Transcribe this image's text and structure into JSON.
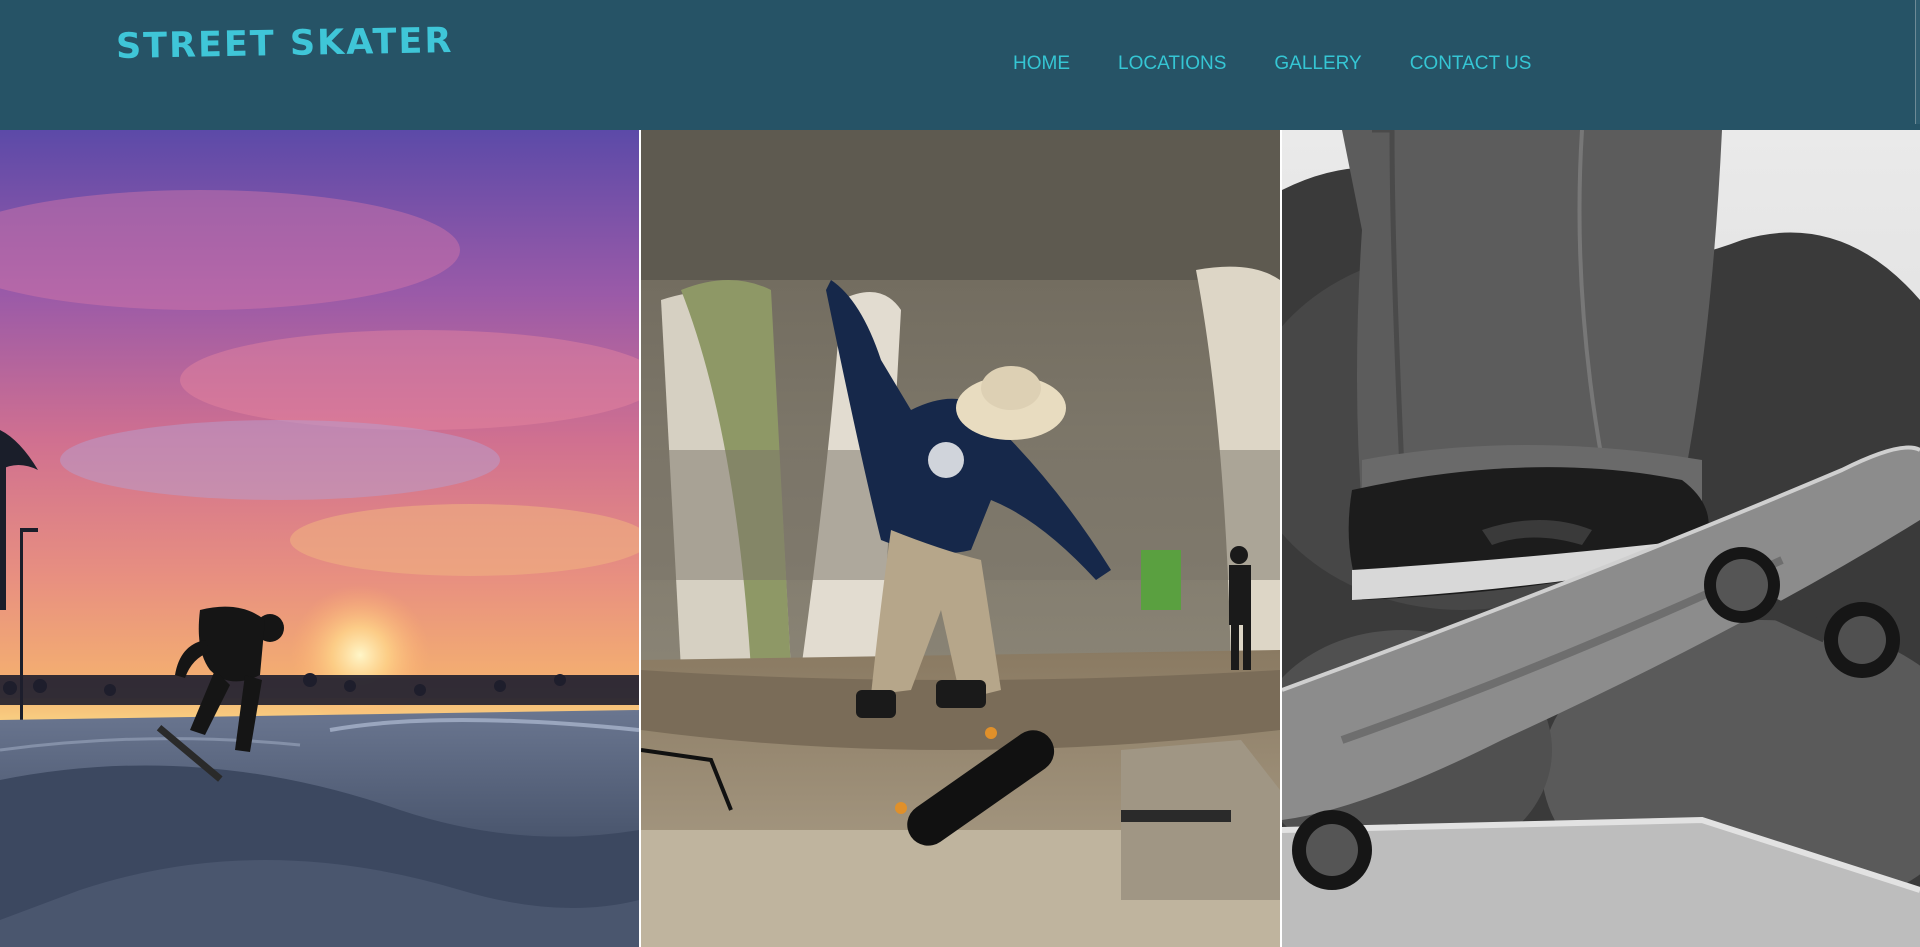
{
  "brand": {
    "logo_text": "STREET SKATER",
    "color": "#3fc6d8"
  },
  "header": {
    "background": "#265366"
  },
  "nav": {
    "items": [
      {
        "label": "HOME"
      },
      {
        "label": "LOCATIONS"
      },
      {
        "label": "GALLERY"
      },
      {
        "label": "CONTACT US"
      }
    ],
    "color": "#35c6d4"
  },
  "gallery": {
    "images": [
      {
        "name": "sunset-skatepark-photo",
        "description": "skater at sunset skatepark"
      },
      {
        "name": "kickflip-under-bridge-photo",
        "description": "skater kickflip under bridge"
      },
      {
        "name": "skateboard-closeup-bw-photo",
        "description": "black and white skateboard closeup"
      }
    ]
  }
}
